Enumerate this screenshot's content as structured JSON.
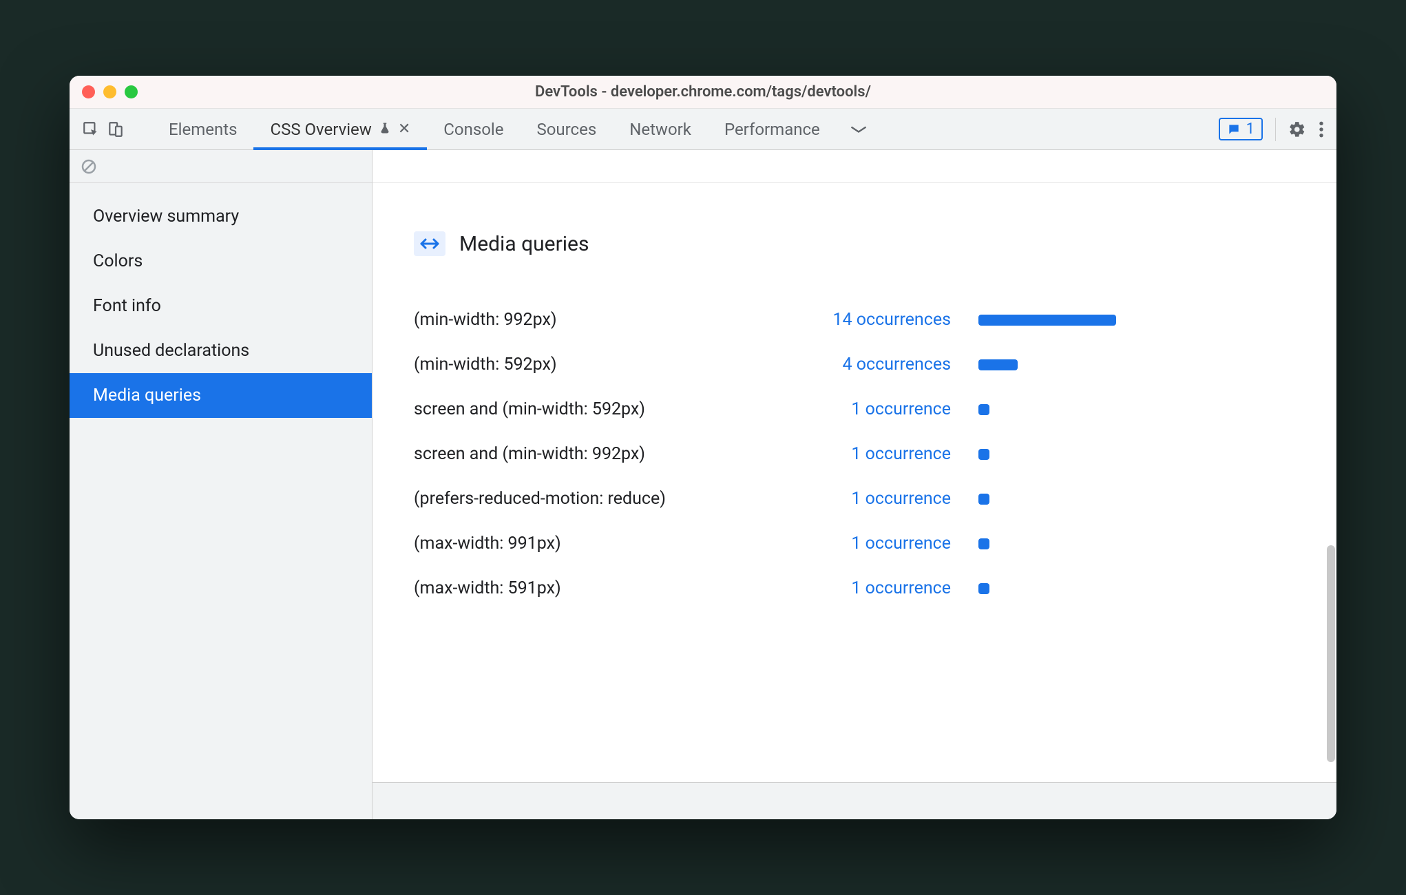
{
  "window": {
    "title": "DevTools - developer.chrome.com/tags/devtools/"
  },
  "toolbar": {
    "tabs": [
      {
        "label": "Elements"
      },
      {
        "label": "CSS Overview",
        "active": true,
        "experimental": true,
        "closable": true
      },
      {
        "label": "Console"
      },
      {
        "label": "Sources"
      },
      {
        "label": "Network"
      },
      {
        "label": "Performance"
      }
    ],
    "issues_count": "1"
  },
  "sidebar": {
    "items": [
      {
        "label": "Overview summary"
      },
      {
        "label": "Colors"
      },
      {
        "label": "Font info"
      },
      {
        "label": "Unused declarations"
      },
      {
        "label": "Media queries",
        "selected": true
      }
    ]
  },
  "panel": {
    "title": "Media queries",
    "rows": [
      {
        "query": "(min-width: 992px)",
        "count_label": "14 occurrences",
        "count": 14
      },
      {
        "query": "(min-width: 592px)",
        "count_label": "4 occurrences",
        "count": 4
      },
      {
        "query": "screen and (min-width: 592px)",
        "count_label": "1 occurrence",
        "count": 1
      },
      {
        "query": "screen and (min-width: 992px)",
        "count_label": "1 occurrence",
        "count": 1
      },
      {
        "query": "(prefers-reduced-motion: reduce)",
        "count_label": "1 occurrence",
        "count": 1
      },
      {
        "query": "(max-width: 991px)",
        "count_label": "1 occurrence",
        "count": 1
      },
      {
        "query": "(max-width: 591px)",
        "count_label": "1 occurrence",
        "count": 1
      }
    ]
  },
  "chart_data": {
    "type": "bar",
    "title": "Media queries",
    "categories": [
      "(min-width: 992px)",
      "(min-width: 592px)",
      "screen and (min-width: 592px)",
      "screen and (min-width: 992px)",
      "(prefers-reduced-motion: reduce)",
      "(max-width: 991px)",
      "(max-width: 591px)"
    ],
    "values": [
      14,
      4,
      1,
      1,
      1,
      1,
      1
    ],
    "xlabel": "occurrences",
    "ylabel": "",
    "ylim": [
      0,
      14
    ]
  }
}
